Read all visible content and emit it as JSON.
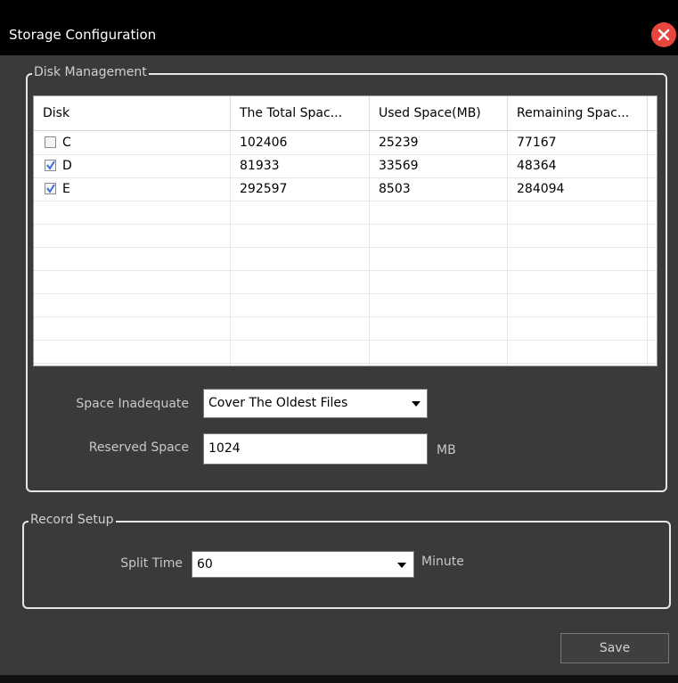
{
  "window": {
    "title": "Storage Configuration",
    "close_icon": "close-icon"
  },
  "disk_group": {
    "label": "Disk Management",
    "columns": [
      "Disk",
      "The Total Spac...",
      "Used Space(MB)",
      "Remaining Spac..."
    ],
    "rows": [
      {
        "disk": "C",
        "checked": false,
        "total": "102406",
        "used": "25239",
        "remaining": "77167"
      },
      {
        "disk": "D",
        "checked": true,
        "total": "81933",
        "used": "33569",
        "remaining": "48364"
      },
      {
        "disk": "E",
        "checked": true,
        "total": "292597",
        "used": "8503",
        "remaining": "284094"
      }
    ],
    "space_inadequate_label": "Space Inadequate",
    "space_inadequate_value": "Cover The Oldest Files",
    "reserved_space_label": "Reserved Space",
    "reserved_space_value": "1024",
    "reserved_unit": "MB"
  },
  "record_group": {
    "label": "Record Setup",
    "split_time_label": "Split Time",
    "split_time_value": "60",
    "split_time_unit": "Minute"
  },
  "footer": {
    "save_label": "Save"
  },
  "colors": {
    "titlebar": "#000000",
    "background": "#3a3a3a",
    "close": "#e8453c",
    "check": "#3a6fd8"
  }
}
